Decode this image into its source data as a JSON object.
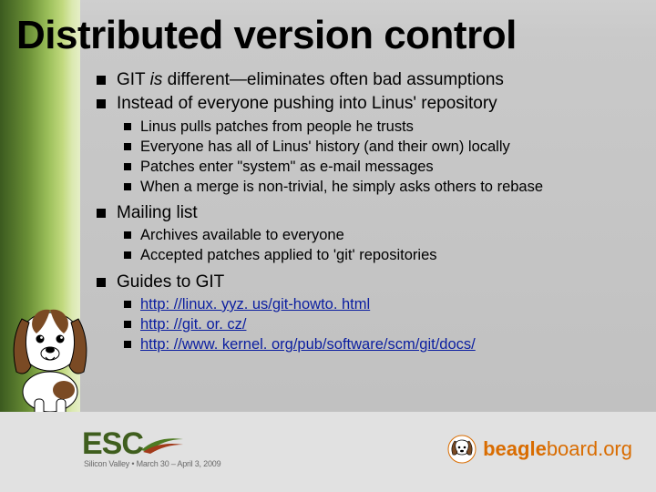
{
  "title": "Distributed version control",
  "bullets": {
    "b1_pre": "GIT ",
    "b1_em": "is",
    "b1_post": " different—eliminates often bad assumptions",
    "b2": "Instead of everyone pushing into Linus' repository",
    "b2_sub": [
      "Linus pulls patches from people he trusts",
      "Everyone has all of Linus' history (and their own) locally",
      "Patches enter \"system\" as e-mail messages",
      "When a merge is non-trivial, he simply asks others to rebase"
    ],
    "b3": "Mailing list",
    "b3_sub": [
      "Archives available to everyone",
      "Accepted patches applied to 'git' repositories"
    ],
    "b4": "Guides to GIT",
    "b4_links": [
      "http: //linux. yyz. us/git-howto. html",
      "http: //git. or. cz/",
      "http: //www. kernel. org/pub/software/scm/git/docs/"
    ]
  },
  "footer": {
    "esc_main": "ESC",
    "esc_sub": "Silicon Valley • March 30 – April 3, 2009",
    "bb_bold": "beagle",
    "bb_rest": "board.org"
  }
}
